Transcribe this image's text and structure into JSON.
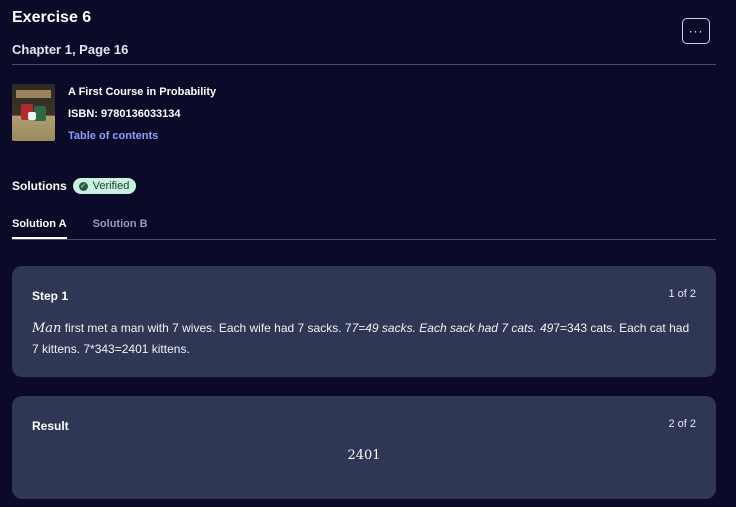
{
  "header": {
    "title": "Exercise 6",
    "subtitle": "Chapter 1, Page 16",
    "more_label": "···"
  },
  "book": {
    "title": "A First Course in Probability",
    "isbn": "ISBN: 9780136033134",
    "toc_link": "Table of contents"
  },
  "solutions": {
    "label": "Solutions",
    "badge": "Verified",
    "badge_icon": "check-badge-icon"
  },
  "tabs": [
    {
      "label": "Solution A",
      "active": true
    },
    {
      "label": "Solution B",
      "active": false
    }
  ],
  "step": {
    "label": "Step 1",
    "count": "1 of 2",
    "math_var": "Man",
    "text_part1": " first met a man with 7 wives. Each wife had 7 sacks. 7",
    "text_italic": "7=49 sacks. Each sack had 7 cats. 49",
    "text_part2": "7=343 cats. Each cat had 7 kittens. 7*343=2401 kittens."
  },
  "result": {
    "label": "Result",
    "count": "2 of 2",
    "value": "2401"
  },
  "colors": {
    "background": "#0b0a29",
    "card": "#2f3755",
    "link": "#8e9cff",
    "badge": "#c8f2df"
  }
}
